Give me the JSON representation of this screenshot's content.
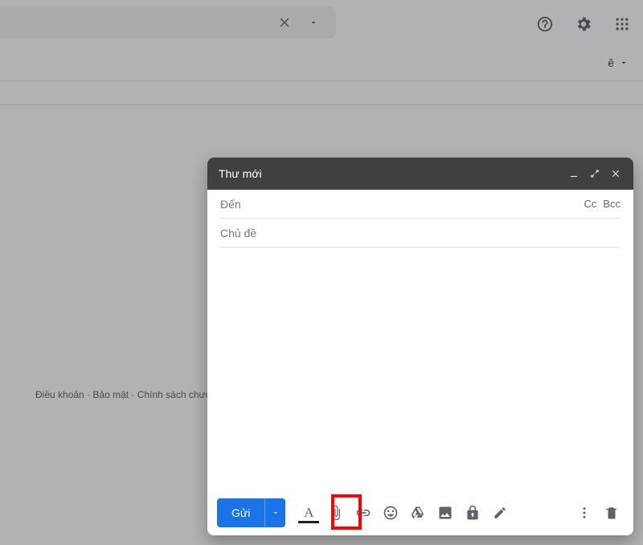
{
  "search": {
    "placeholder": ""
  },
  "account": {
    "initial": "ê"
  },
  "footer": {
    "terms": "Điều khoản",
    "privacy": "Bảo mật",
    "policies": "Chính sách chươ"
  },
  "compose": {
    "title": "Thư mới",
    "to_label": "Đến",
    "cc_label": "Cc",
    "bcc_label": "Bcc",
    "subject_placeholder": "Chủ đề",
    "send_label": "Gửi"
  }
}
